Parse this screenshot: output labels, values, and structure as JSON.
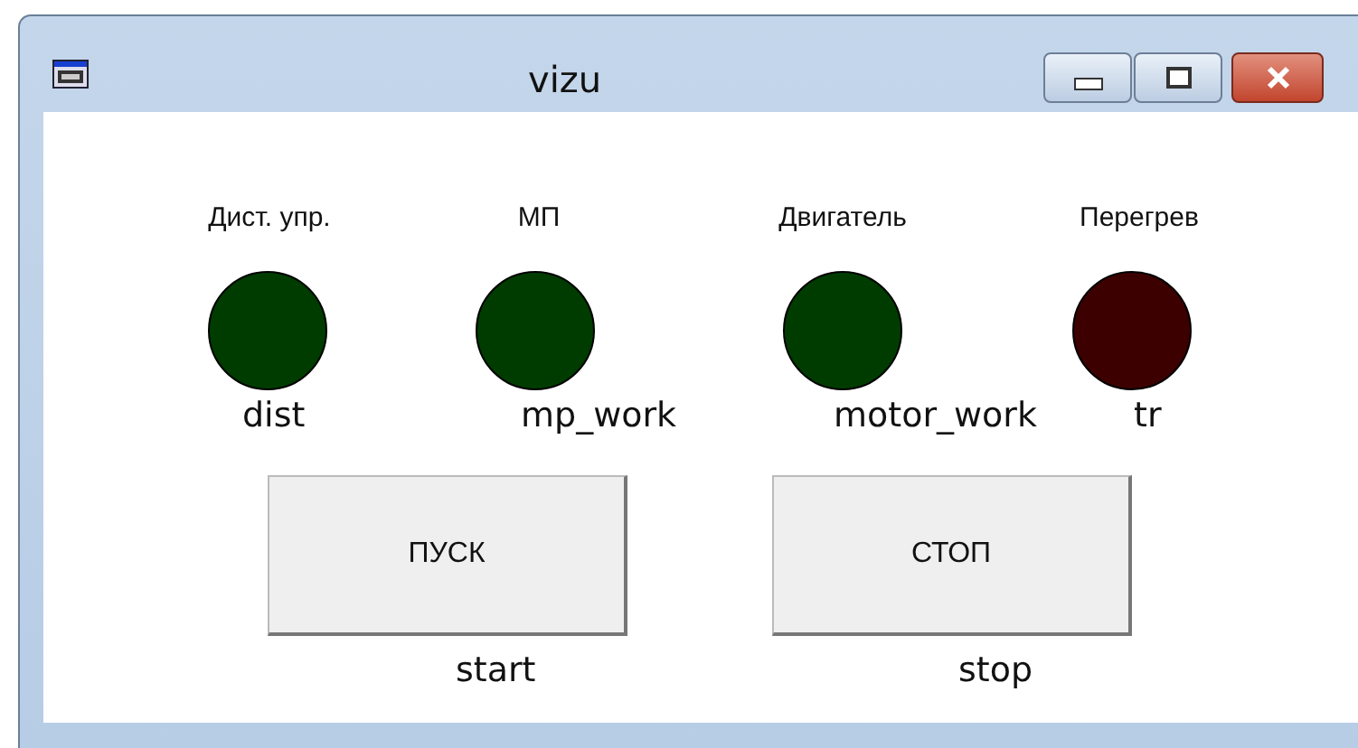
{
  "window": {
    "title": "vizu"
  },
  "indicators": [
    {
      "label": "Дист. упр.",
      "tag": "dist",
      "color": "#003c00"
    },
    {
      "label": "МП",
      "tag": "mp_work",
      "color": "#003c00"
    },
    {
      "label": "Двигатель",
      "tag": "motor_work",
      "color": "#003c00"
    },
    {
      "label": "Перегрев",
      "tag": "tr",
      "color": "#3c0000"
    }
  ],
  "buttons": [
    {
      "label": "ПУСК",
      "tag": "start"
    },
    {
      "label": "СТОП",
      "tag": "stop"
    }
  ]
}
